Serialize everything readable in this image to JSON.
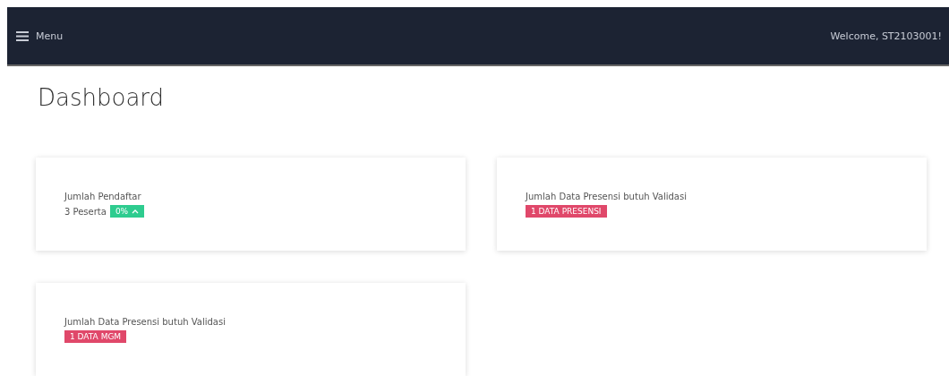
{
  "navbar": {
    "menu_label": "Menu",
    "welcome": "Welcome, ST2103001!"
  },
  "page_title": "Dashboard",
  "cards": [
    {
      "label": "Jumlah Pendaftar",
      "value": "3 Peserta",
      "badge": {
        "text": "0%",
        "color": "#2ecc8f",
        "rising": true
      }
    },
    {
      "label": "Jumlah Data Presensi butuh Validasi",
      "badge": {
        "text": "1 DATA PRESENSI",
        "color": "#e0486a"
      }
    },
    {
      "label": "Jumlah Data Presensi butuh Validasi",
      "badge": {
        "text": "1 DATA MGM",
        "color": "#e0486a"
      }
    }
  ]
}
